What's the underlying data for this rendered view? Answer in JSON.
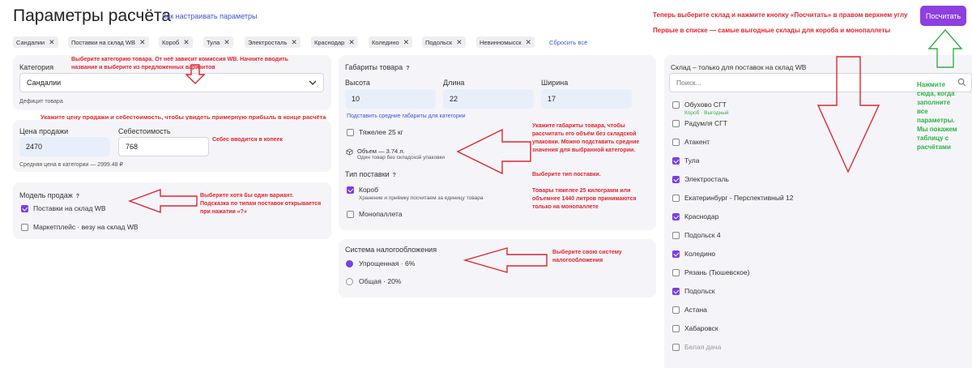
{
  "header": {
    "title": "Параметры расчёта",
    "how_link": "Как настраивать параметры",
    "calc_button": "Посчитать",
    "note_top1": "Теперь выберите склад и нажмите кнопку «Посчитать» в правом верхнем углу",
    "note_top2": "Первые в списке — самые выгодные склады для короба и монопаллеты"
  },
  "chips": [
    "Сандалии",
    "Поставки на склад WB",
    "Короб",
    "Тула",
    "Электросталь",
    "Краснодар",
    "Коледино",
    "Подольск",
    "Невинномысск"
  ],
  "reset_all": "Сбросить всё",
  "category": {
    "label": "Категория",
    "value": "Сандалии",
    "deficit": "Дефицит товара",
    "note": "Выберите категорию товара. От неё зависит комиссия WB. Начните вводить название и выберите из предложенных вариантов"
  },
  "price_note": "Укажите цену продажи и себестоимость, чтобы увидеть примерную прибыль в конце расчёта",
  "price": {
    "sale_label": "Цена продажи",
    "sale_value": "2470",
    "cost_label": "Себестоимость",
    "cost_value": "768",
    "avg": "Средняя цена в категории — 2999.48 ₽",
    "cost_note": "Себес вводится в копеек"
  },
  "sales_model": {
    "label": "Модель продаж",
    "help": "?",
    "options": [
      {
        "label": "Поставки на склад WB",
        "checked": true
      },
      {
        "label": "Маркетплейс · везу на склад WB",
        "checked": false
      }
    ],
    "note": "Выберите хотя бы один вариант. Подсказка по типам поставок открывается при нажатии «?»"
  },
  "dimensions": {
    "label": "Габариты товара",
    "help": "?",
    "height_label": "Высота",
    "height_value": "10",
    "length_label": "Длина",
    "length_value": "22",
    "width_label": "Ширина",
    "width_value": "17",
    "avg_link": "Подставить средние габариты для категории",
    "heavy_label": "Тяжелее 25 кг",
    "volume": "Объем — 3.74 л.",
    "volume_sub": "Один товар без складской упаковки",
    "note": "Укажите габариты товара, чтобы рассчитать его объём без складской упаковки. Можно подставить средние значения для выбранной категории."
  },
  "supply_type": {
    "label": "Тип поставки",
    "help": "?",
    "box_label": "Короб",
    "box_sub": "Хранение и приёмку посчитаем за единицу товара",
    "pallet_label": "Монопаллета",
    "note1": "Выберите тип поставки.",
    "note2": "Товары тяжелее 25 килограмм или объемнее 1440 литров принимаются только на монопаллете"
  },
  "tax": {
    "label": "Система налогообложения",
    "options": [
      {
        "label": "Упрощенная · 6%",
        "selected": true
      },
      {
        "label": "Общая · 20%",
        "selected": false
      }
    ],
    "note": "Выберите свою систему налогообложения"
  },
  "warehouses": {
    "label": "Склад – только для поставок на склад WB",
    "search_placeholder": "Поиск...",
    "items": [
      {
        "name": "Обухово СГТ",
        "sub": "Короб · Выгодный",
        "checked": false
      },
      {
        "name": "Радумля СГТ",
        "checked": false
      },
      {
        "name": "Атакент",
        "checked": false
      },
      {
        "name": "Тула",
        "checked": true
      },
      {
        "name": "Электросталь",
        "checked": true
      },
      {
        "name": "Екатеринбург - Перспективный 12",
        "checked": false
      },
      {
        "name": "Краснодар",
        "checked": true
      },
      {
        "name": "Подольск 4",
        "checked": false
      },
      {
        "name": "Коледино",
        "checked": true
      },
      {
        "name": "Рязань (Тюшевское)",
        "checked": false
      },
      {
        "name": "Подольск",
        "checked": true
      },
      {
        "name": "Астана",
        "checked": false
      },
      {
        "name": "Хабаровск",
        "checked": false
      },
      {
        "name": "Белая дача",
        "checked": false
      }
    ],
    "note": "Нажмите сюда, когда заполните все параметры. Мы покажем таблицу с расчётами"
  },
  "colors": {
    "accent": "#8e3fe0",
    "annotation_red": "#e0262e",
    "annotation_green": "#2fb344",
    "link": "#3a57d6"
  }
}
